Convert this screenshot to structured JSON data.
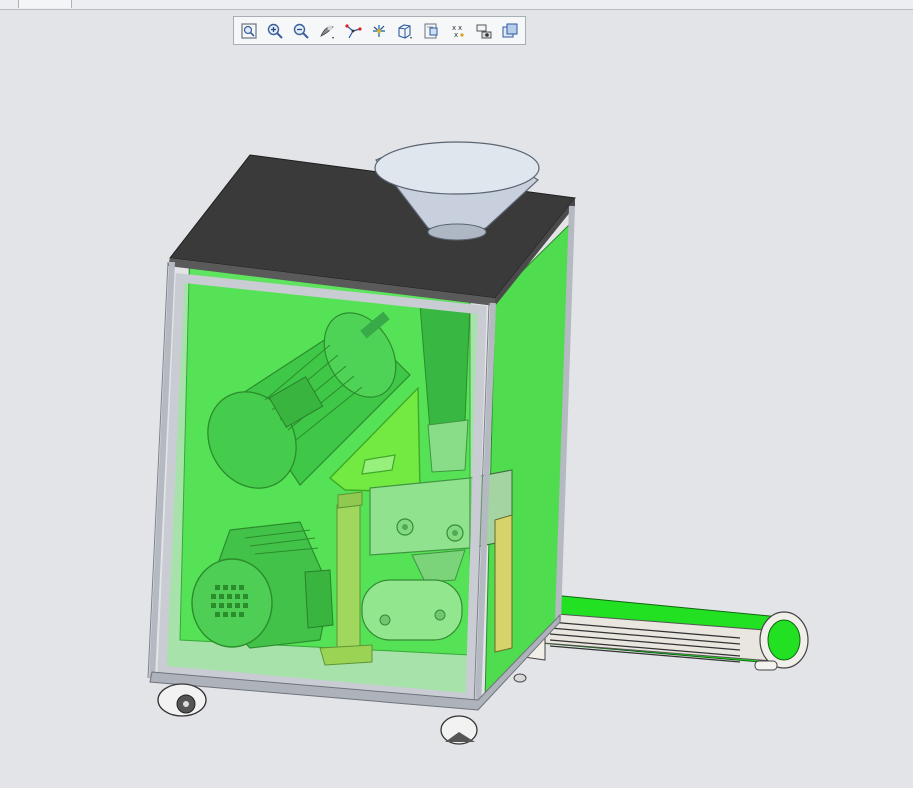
{
  "window": {
    "tab_label": ""
  },
  "toolbar": {
    "buttons": [
      {
        "name": "zoom-fit-button",
        "icon": "zoom-fit-icon"
      },
      {
        "name": "zoom-in-button",
        "icon": "zoom-in-icon"
      },
      {
        "name": "zoom-out-button",
        "icon": "zoom-out-icon"
      },
      {
        "name": "shading-button",
        "icon": "shading-icon"
      },
      {
        "name": "datum-axis-button",
        "icon": "axis-icon"
      },
      {
        "name": "spin-center-button",
        "icon": "spin-center-icon"
      },
      {
        "name": "view-orientation-button",
        "icon": "cube-view-icon"
      },
      {
        "name": "saved-views-button",
        "icon": "saved-views-icon"
      },
      {
        "name": "datum-points-button",
        "icon": "datum-points-icon"
      },
      {
        "name": "model-tree-display-button",
        "icon": "model-tree-icon"
      },
      {
        "name": "appearance-button",
        "icon": "appearance-icon"
      }
    ]
  },
  "colors": {
    "background": "#e3e4e8",
    "enclosure_glass": "#46e046",
    "top_plate": "#3a3a3a",
    "frame": "#c9ccd2",
    "conveyor_belt": "#22e022",
    "highlight_bracket": "#8ef040"
  }
}
